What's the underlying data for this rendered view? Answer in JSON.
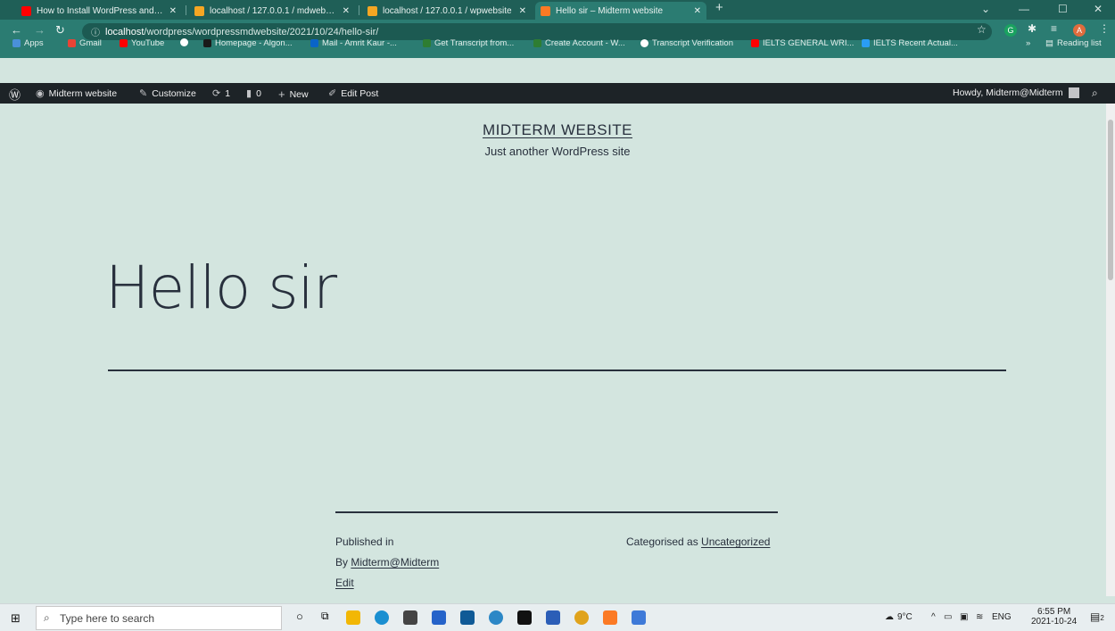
{
  "browser": {
    "tabs": [
      {
        "title": "How to Install WordPress and Se",
        "favicon_color": "#ff0000"
      },
      {
        "title": "localhost / 127.0.0.1 / mdwebsite",
        "favicon_color": "#f5a623"
      },
      {
        "title": "localhost / 127.0.0.1 / wpwebsite",
        "favicon_color": "#f5a623"
      },
      {
        "title": "Hello sir – Midterm website",
        "favicon_color": "#fb7a24",
        "active": true
      }
    ],
    "new_tab_label": "+",
    "url_host": "localhost",
    "url_path": "/wordpress/wordpressmdwebsite/2021/10/24/hello-sir/",
    "profile_initial": "A",
    "ext_g": "G",
    "bookmarks": [
      {
        "label": "Apps",
        "color": "#4a90d9"
      },
      {
        "label": "Gmail",
        "color": "#ea4335"
      },
      {
        "label": "YouTube",
        "color": "#ff0000"
      },
      {
        "label": "",
        "color": "#ffffff"
      },
      {
        "label": "Homepage - Algon...",
        "color": "#1a1a1a"
      },
      {
        "label": "Mail - Amrit Kaur -...",
        "color": "#0a64c8"
      },
      {
        "label": "Get Transcript from...",
        "color": "#2e7d32"
      },
      {
        "label": "Create Account - W...",
        "color": "#2e7d32"
      },
      {
        "label": "Transcript Verification",
        "color": "#ffffff"
      },
      {
        "label": "IELTS GENERAL WRI...",
        "color": "#ff0000"
      },
      {
        "label": "IELTS Recent Actual...",
        "color": "#2a9df4"
      }
    ],
    "bookmarks_more": "»",
    "reading_list": "Reading list"
  },
  "adminbar": {
    "site_name": "Midterm website",
    "customize": "Customize",
    "updates": "1",
    "comments": "0",
    "new": "New",
    "edit_post": "Edit Post",
    "howdy": "Howdy, Midterm@Midterm"
  },
  "page": {
    "site_title": "MIDTERM WEBSITE",
    "tagline": "Just another WordPress site",
    "post_title": "Hello sir",
    "published_in": "Published in",
    "by_prefix": "By ",
    "author": "Midterm@Midterm",
    "edit": "Edit",
    "categorised_prefix": "Categorised as ",
    "category": "Uncategorized"
  },
  "taskbar": {
    "search_placeholder": "Type here to search",
    "temperature": "9°C",
    "language": "ENG",
    "time": "6:55 PM",
    "date": "2021-10-24",
    "notification_count": "2"
  }
}
